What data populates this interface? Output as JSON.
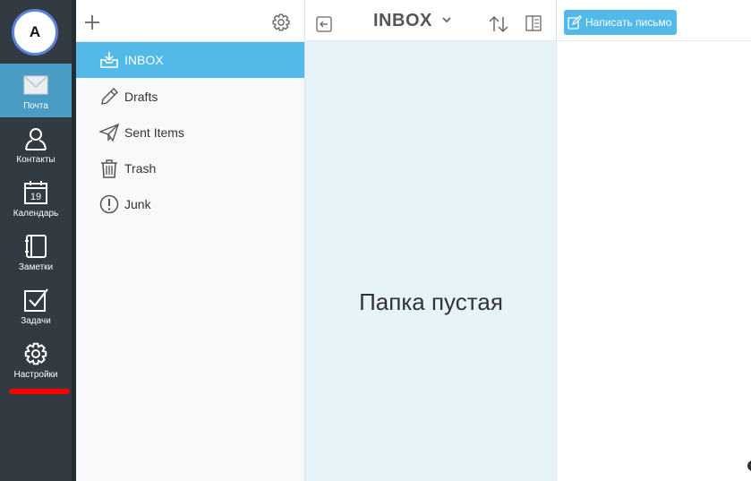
{
  "user": {
    "avatar_letter": "A"
  },
  "rail": {
    "items": [
      {
        "label": "Почта",
        "icon": "mail-icon"
      },
      {
        "label": "Контакты",
        "icon": "contacts-icon"
      },
      {
        "label": "Календарь",
        "icon": "calendar-icon",
        "calendar_day": "19"
      },
      {
        "label": "Заметки",
        "icon": "notes-icon"
      },
      {
        "label": "Задачи",
        "icon": "tasks-icon"
      },
      {
        "label": "Настройки",
        "icon": "gear-icon"
      }
    ],
    "active_index": 0
  },
  "folders": {
    "items": [
      {
        "name": "INBOX",
        "icon": "inbox-icon"
      },
      {
        "name": "Drafts",
        "icon": "pencil-icon"
      },
      {
        "name": "Sent Items",
        "icon": "paper-plane-icon"
      },
      {
        "name": "Trash",
        "icon": "trash-icon"
      },
      {
        "name": "Junk",
        "icon": "warning-icon"
      }
    ],
    "active_index": 0
  },
  "message_list": {
    "title": "INBOX",
    "empty_text": "Папка пустая"
  },
  "reader": {
    "compose_label": "Написать письмо"
  },
  "colors": {
    "rail_bg": "#323b41",
    "rail_active": "#4a9cc4",
    "accent": "#52b9e8",
    "list_bg": "#e6f4fa",
    "highlight_underline": "#ff0000",
    "avatar_ring": "#5f82e0"
  }
}
